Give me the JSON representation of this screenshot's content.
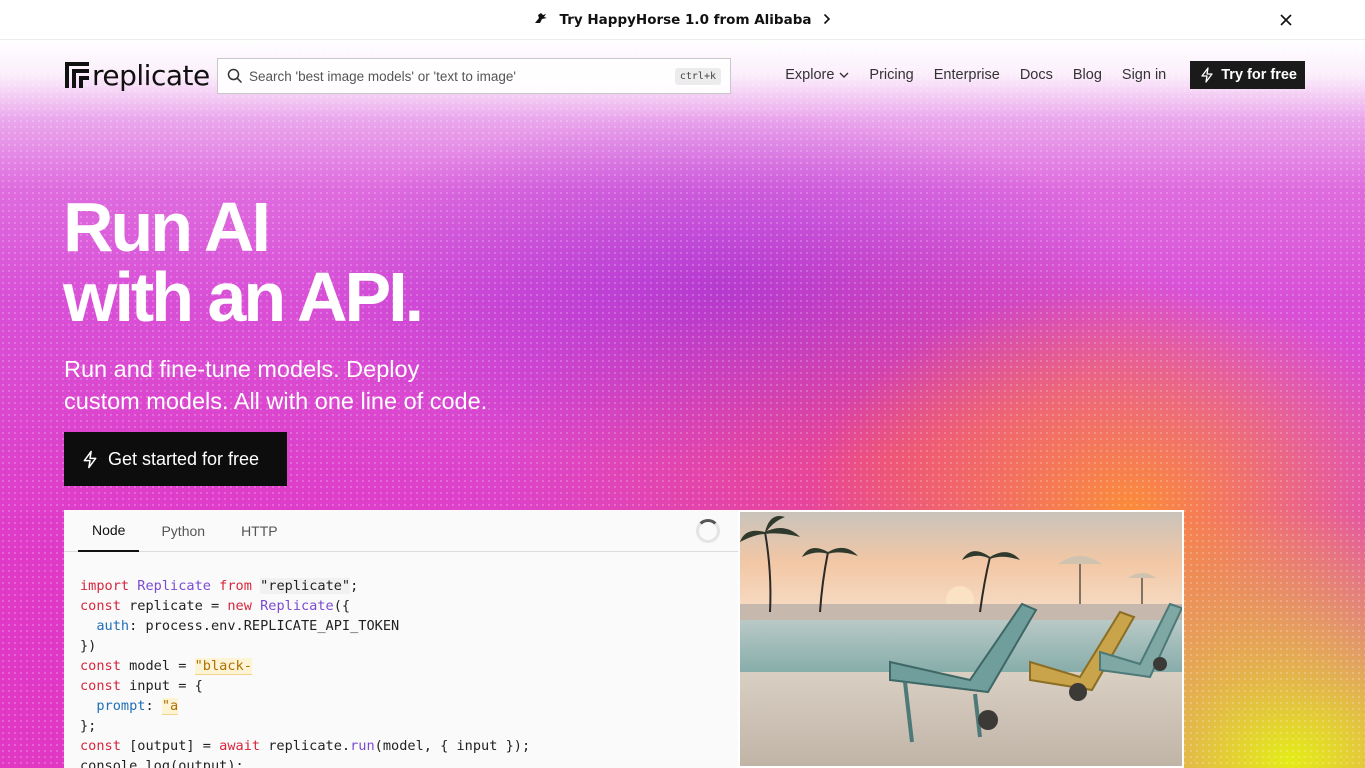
{
  "announcement": {
    "text": "Try HappyHorse 1.0 from Alibaba",
    "icon": "horse-icon"
  },
  "nav": {
    "logo_text": "replicate",
    "search_placeholder": "Search 'best image models' or 'text to image'",
    "search_shortcut": "ctrl+k",
    "links": [
      "Explore",
      "Pricing",
      "Enterprise",
      "Docs",
      "Blog",
      "Sign in"
    ],
    "cta": "Try for free"
  },
  "hero": {
    "headline_line1": "Run AI",
    "headline_line2": "with an API.",
    "subline_line1": "Run and fine-tune models. Deploy",
    "subline_line2": "custom models. All with one line of code.",
    "cta": "Get started for free"
  },
  "code_card": {
    "tabs": [
      "Node",
      "Python",
      "HTTP"
    ],
    "active_tab": "Node",
    "code": {
      "l1_kw1": "import",
      "l1_cls": "Replicate",
      "l1_kw2": "from",
      "l1_str": "\"replicate\"",
      "l1_end": ";",
      "l2_kw": "const",
      "l2_mid": " replicate = ",
      "l2_new": "new",
      "l2_cls": "Replicate",
      "l2_end": "({",
      "l3_prop": "auth",
      "l3_rest": ": process.env.REPLICATE_API_TOKEN",
      "l4": "})",
      "l5_kw": "const",
      "l5_mid": " model = ",
      "l5_val": "\"black-",
      "l6_kw": "const",
      "l6_mid": " input = {",
      "l7_prop": "prompt",
      "l7_mid": ": ",
      "l7_val": "\"a",
      "l8": "};",
      "l9_kw": "const",
      "l9_mid": " [output] = ",
      "l9_await": "await",
      "l9_pre": " replicate.",
      "l9_fn": "run",
      "l9_end": "(model, { input });",
      "l10": "console.log(output);"
    }
  },
  "colors": {
    "accent_dark": "#0d0d0d",
    "hero_magenta": "#de3fc6",
    "hero_orange": "#ff9628",
    "hero_yellow": "#e4f014"
  }
}
